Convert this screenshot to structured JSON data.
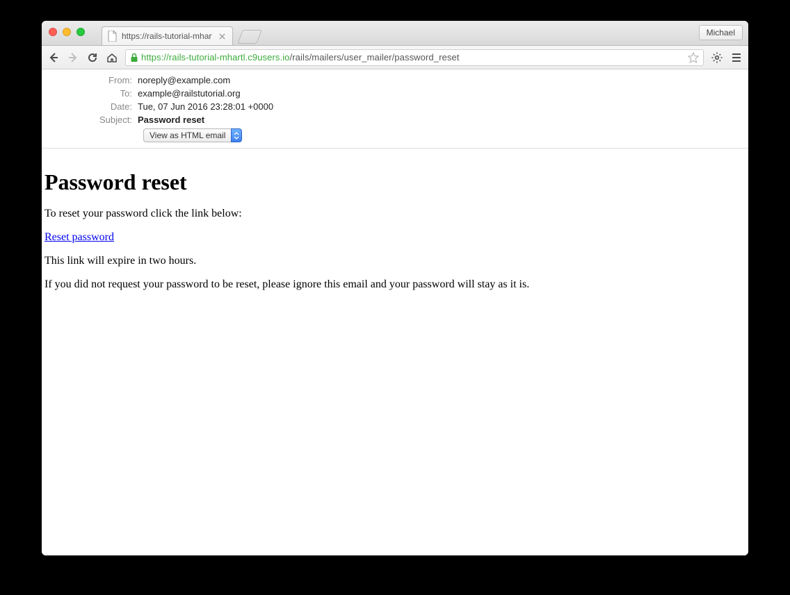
{
  "browser": {
    "profile_name": "Michael",
    "tab_title": "https://rails-tutorial-mhartl",
    "url_proto": "https",
    "url_host": "://rails-tutorial-mhartl.c9users.io",
    "url_path": "/rails/mailers/user_mailer/password_reset"
  },
  "mail_header": {
    "from_label": "From:",
    "from_value": "noreply@example.com",
    "to_label": "To:",
    "to_value": "example@railstutorial.org",
    "date_label": "Date:",
    "date_value": "Tue, 07 Jun 2016 23:28:01 +0000",
    "subject_label": "Subject:",
    "subject_value": "Password reset",
    "format_selected": "View as HTML email"
  },
  "email": {
    "heading": "Password reset",
    "p1": "To reset your password click the link below:",
    "link_text": "Reset password",
    "p2": "This link will expire in two hours.",
    "p3": "If you did not request your password to be reset, please ignore this email and your password will stay as it is."
  }
}
